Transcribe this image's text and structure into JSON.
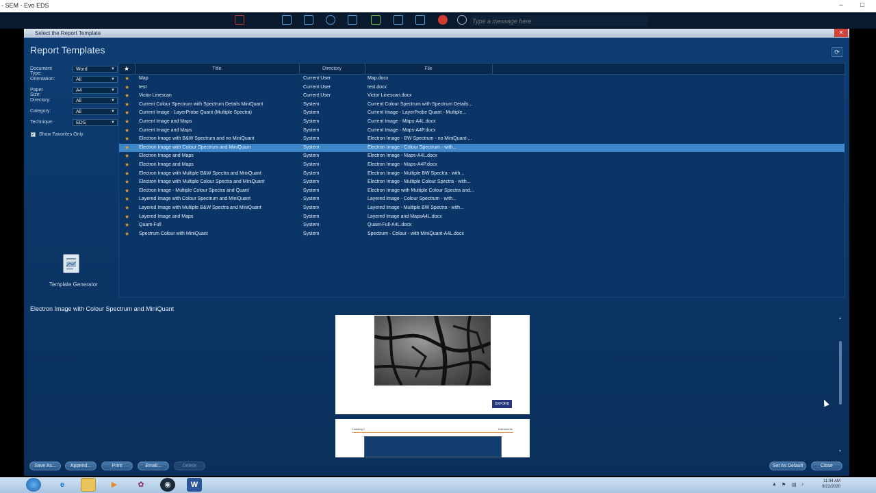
{
  "app": {
    "title": "- SEM - Evo EDS"
  },
  "remote_toolbar": {
    "message_placeholder": "Type a message here"
  },
  "dialog": {
    "title": "Select the Report Template",
    "heading": "Report Templates",
    "filters": [
      {
        "label": "Document Type:",
        "value": "Word"
      },
      {
        "label": "Orientation:",
        "value": "All"
      },
      {
        "label": "Paper Size:",
        "value": "A4"
      },
      {
        "label": "Directory:",
        "value": "All"
      },
      {
        "label": "Category:",
        "value": "All"
      },
      {
        "label": "Technique:",
        "value": "EDS"
      }
    ],
    "show_favorites_label": "Show Favorites Only",
    "template_generator_label": "Template Generator",
    "columns": {
      "fav": "★",
      "title": "Title",
      "directory": "Directory",
      "file": "File"
    },
    "rows": [
      {
        "title": "Map",
        "directory": "Current User",
        "file": "Map.docx"
      },
      {
        "title": "test",
        "directory": "Current User",
        "file": "test.docx"
      },
      {
        "title": "Victor Linescan",
        "directory": "Current User",
        "file": "Victor Linescan.docx"
      },
      {
        "title": "Current Colour Spectrum with Spectrum Details MiniQuant",
        "directory": "System",
        "file": "Current Colour Spectrum with Spectrum Details..."
      },
      {
        "title": "Current Image - LayerProbe Quant (Multiple Spectra)",
        "directory": "System",
        "file": "Current Image - LayerProbe Quant - Multiple..."
      },
      {
        "title": "Current Image and Maps",
        "directory": "System",
        "file": "Current Image - Maps-A4L.docx"
      },
      {
        "title": "Current Image and Maps",
        "directory": "System",
        "file": "Current Image - Maps-A4P.docx"
      },
      {
        "title": "Electron Image with B&W Spectrum and no MiniQuant",
        "directory": "System",
        "file": "Electron Image - BW Spectrum - no MiniQuant-..."
      },
      {
        "title": "Electron Image with Colour Spectrum and MiniQuant",
        "directory": "System",
        "file": "Electron Image - Colour Spectrum - with..."
      },
      {
        "title": "Electron Image and Maps",
        "directory": "System",
        "file": "Electron Image - Maps-A4L.docx"
      },
      {
        "title": "Electron Image and Maps",
        "directory": "System",
        "file": "Electron Image - Maps-A4P.docx"
      },
      {
        "title": "Electron Image with Multiple B&W Spectra and MiniQuant",
        "directory": "System",
        "file": "Electron Image - Multiple BW Spectra - with..."
      },
      {
        "title": "Electron Image with Multiple Colour Spectra and MiniQuant",
        "directory": "System",
        "file": "Electron Image - Multiple Colour Spectra - with..."
      },
      {
        "title": "Electron Image - Multiple Colour Spectra and Quant",
        "directory": "System",
        "file": "Electron Image with Multiple Colour Spectra and..."
      },
      {
        "title": "Layered Image with Colour Spectrum and MiniQuant",
        "directory": "System",
        "file": "Layered Image - Colour Spectrum - with..."
      },
      {
        "title": "Layered Image with Multiple B&W Spectra and MiniQuant",
        "directory": "System",
        "file": "Layered Image - Multiple BW Spectra - with..."
      },
      {
        "title": "Layered Image and Maps",
        "directory": "System",
        "file": "Layered Image and MapsA4L.docx"
      },
      {
        "title": "Quant-Full",
        "directory": "System",
        "file": "Quant-Full-A4L.docx"
      },
      {
        "title": "Spectrum Colour with MiniQuant",
        "directory": "System",
        "file": "Spectrum - Colour - with MiniQuant-A4L.docx"
      }
    ],
    "selected_row": 8,
    "preview_heading": "Electron Image with Colour Spectrum and MiniQuant",
    "preview": {
      "logo_text": "OXFORD",
      "page2_left": "Drawing 1",
      "page2_right": "Instruments"
    },
    "buttons": {
      "save_as": "Save As...",
      "append": "Append...",
      "print": "Print",
      "email": "Email...",
      "delete": "Delete",
      "set_default": "Set As Default",
      "close": "Close"
    }
  },
  "taskbar": {
    "time": "11:04 AM",
    "date": "9/22/2020"
  },
  "colors": {
    "dialog_bg": "#0b3565",
    "selection": "#3e86c8",
    "star": "#e7a22e"
  }
}
